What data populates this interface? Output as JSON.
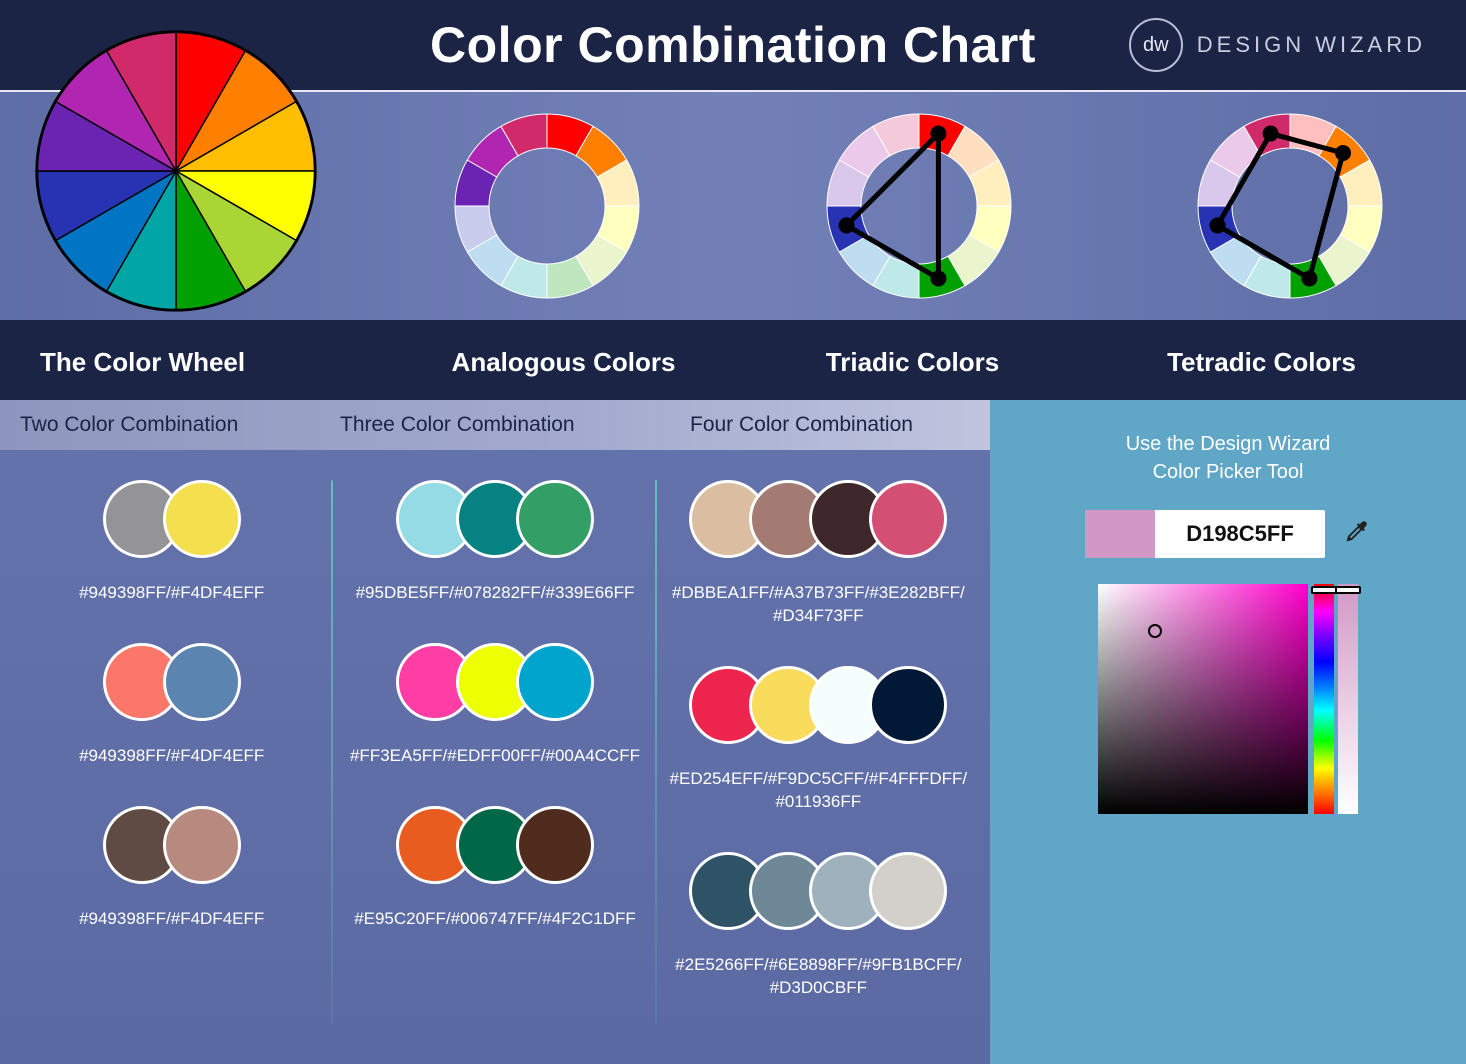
{
  "header": {
    "title": "Color Combination Chart",
    "brand_initials": "dw",
    "brand_name": "DESIGN WIZARD"
  },
  "sections": {
    "wheel": "The Color Wheel",
    "analogous": "Analogous Colors",
    "triadic": "Triadic Colors",
    "tetradic": "Tetradic Colors"
  },
  "tabs": {
    "two": "Two Color Combination",
    "three": "Three Color Combination",
    "four": "Four Color Combination"
  },
  "color_wheel_12": [
    "#ff0000",
    "#ff7f00",
    "#ffbf00",
    "#ffff00",
    "#a9d635",
    "#00a000",
    "#00a6a6",
    "#0075c4",
    "#2733b3",
    "#6b24b2",
    "#b026b0",
    "#d12a6a"
  ],
  "combos": {
    "two": [
      {
        "colors": [
          "#949398",
          "#F4DF4E"
        ],
        "label": "#949398FF/#F4DF4EFF"
      },
      {
        "colors": [
          "#FC766A",
          "#5B84B1"
        ],
        "label": "#949398FF/#F4DF4EFF"
      },
      {
        "colors": [
          "#5F4B44",
          "#B8897F"
        ],
        "label": "#949398FF/#F4DF4EFF"
      }
    ],
    "three": [
      {
        "colors": [
          "#95DBE5",
          "#078282",
          "#339E66"
        ],
        "label": "#95DBE5FF/#078282FF/#339E66FF"
      },
      {
        "colors": [
          "#FF3EA5",
          "#EDFF00",
          "#00A4CC"
        ],
        "label": "#FF3EA5FF/#EDFF00FF/#00A4CCFF"
      },
      {
        "colors": [
          "#E95C20",
          "#006747",
          "#4F2C1D"
        ],
        "label": "#E95C20FF/#006747FF/#4F2C1DFF"
      }
    ],
    "four": [
      {
        "colors": [
          "#DBBEA1",
          "#A37B73",
          "#3E282B",
          "#D34F73"
        ],
        "label": "#DBBEA1FF/#A37B73FF/#3E282BFF/#D34F73FF"
      },
      {
        "colors": [
          "#ED254E",
          "#F9DC5C",
          "#F4FFFD",
          "#011936"
        ],
        "label": "#ED254EFF/#F9DC5CFF/#F4FFFDFF/#011936FF"
      },
      {
        "colors": [
          "#2E5266",
          "#6E8898",
          "#9FB1BC",
          "#D3D0CB"
        ],
        "label": "#2E5266FF/#6E8898FF/#9FB1BCFF/#D3D0CBFF"
      }
    ]
  },
  "picker": {
    "heading_line1": "Use the Design Wizard",
    "heading_line2": "Color Picker Tool",
    "value": "D198C5FF",
    "preview_hex": "#D198C5"
  },
  "chart_data": {
    "type": "table",
    "title": "Color Combination Chart",
    "scheme_types": [
      "The Color Wheel",
      "Analogous Colors",
      "Triadic Colors",
      "Tetradic Colors"
    ],
    "combinations": {
      "Two Color Combination": [
        [
          "#949398FF",
          "#F4DF4EFF"
        ],
        [
          "#949398FF",
          "#F4DF4EFF"
        ],
        [
          "#949398FF",
          "#F4DF4EFF"
        ]
      ],
      "Three Color Combination": [
        [
          "#95DBE5FF",
          "#078282FF",
          "#339E66FF"
        ],
        [
          "#FF3EA5FF",
          "#EDFF00FF",
          "#00A4CCFF"
        ],
        [
          "#E95C20FF",
          "#006747FF",
          "#4F2C1DFF"
        ]
      ],
      "Four Color Combination": [
        [
          "#DBBEA1FF",
          "#A37B73FF",
          "#3E282BFF",
          "#D34F73FF"
        ],
        [
          "#ED254EFF",
          "#F9DC5CFF",
          "#F4FFFDFF",
          "#011936FF"
        ],
        [
          "#2E5266FF",
          "#6E8898FF",
          "#9FB1BCFF",
          "#D3D0CBFF"
        ]
      ]
    },
    "picker_value": "D198C5FF"
  }
}
